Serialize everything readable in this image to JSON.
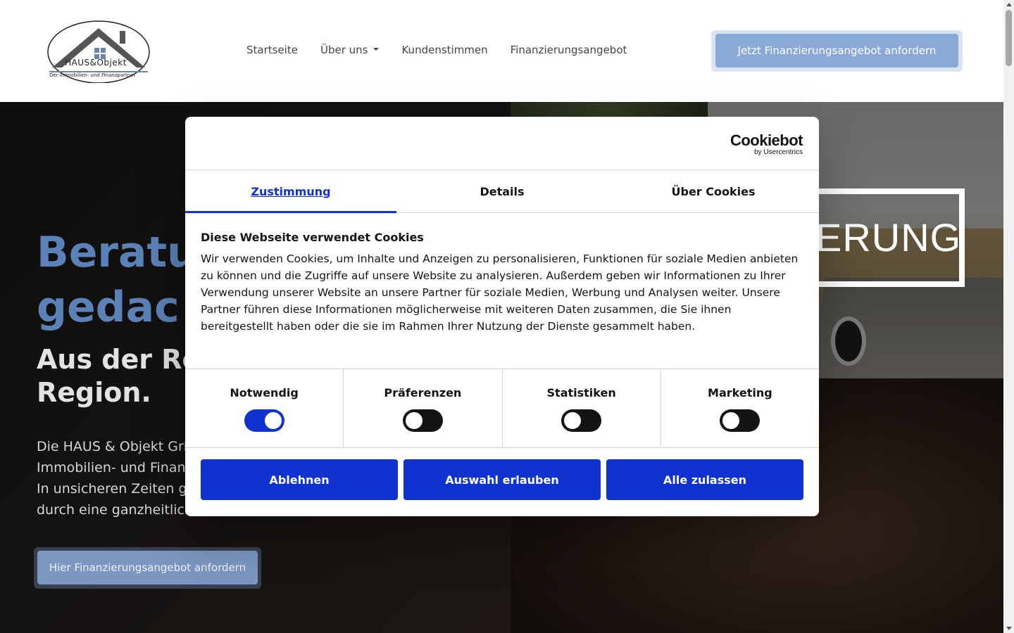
{
  "header": {
    "logo": {
      "brand": "HAUS&Objekt",
      "tagline": "Der Immobilien- und Finanzpartner"
    },
    "nav": [
      {
        "label": "Startseite"
      },
      {
        "label": "Über uns",
        "has_dropdown": true
      },
      {
        "label": "Kundenstimmen"
      },
      {
        "label": "Finanzierungsangebot"
      }
    ],
    "cta_label": "Jetzt Finanzierungsangebot anfordern"
  },
  "hero": {
    "title_line1": "Beratu",
    "title_line2": "gedac",
    "subtitle_line1": "Aus der Re",
    "subtitle_line2": "Region.",
    "text_lines": [
      "Die HAUS & Objekt Gri",
      "Immobilien- und Finan",
      "In unsicheren Zeiten ga",
      "durch eine ganzheitlich"
    ],
    "banner_text": "ERUNG",
    "cta_label": "Hier Finanzierungsangebot anfordern"
  },
  "cookie_dialog": {
    "brand": "Cookiebot",
    "brand_by": "by Usercentrics",
    "tabs": [
      {
        "label": "Zustimmung",
        "active": true
      },
      {
        "label": "Details",
        "active": false
      },
      {
        "label": "Über Cookies",
        "active": false
      }
    ],
    "title": "Diese Webseite verwendet Cookies",
    "text": "Wir verwenden Cookies, um Inhalte und Anzeigen zu personalisieren, Funktionen für soziale Medien anbieten zu können und die Zugriffe auf unsere Website zu analysieren. Außerdem geben wir Informationen zu Ihrer Verwendung unserer Website an unsere Partner für soziale Medien, Werbung und Analysen weiter. Unsere Partner führen diese Informationen möglicherweise mit weiteren Daten zusammen, die Sie ihnen bereitgestellt haben oder die sie im Rahmen Ihrer Nutzung der Dienste gesammelt haben.",
    "categories": [
      {
        "label": "Notwendig",
        "enabled": true
      },
      {
        "label": "Präferenzen",
        "enabled": false
      },
      {
        "label": "Statistiken",
        "enabled": false
      },
      {
        "label": "Marketing",
        "enabled": false
      }
    ],
    "buttons": {
      "decline": "Ablehnen",
      "allow_selection": "Auswahl erlauben",
      "allow_all": "Alle zulassen"
    }
  },
  "colors": {
    "accent_blue": "#1032cf",
    "brand_blue": "#5b82b8",
    "header_cta": "#8aa9d6"
  }
}
